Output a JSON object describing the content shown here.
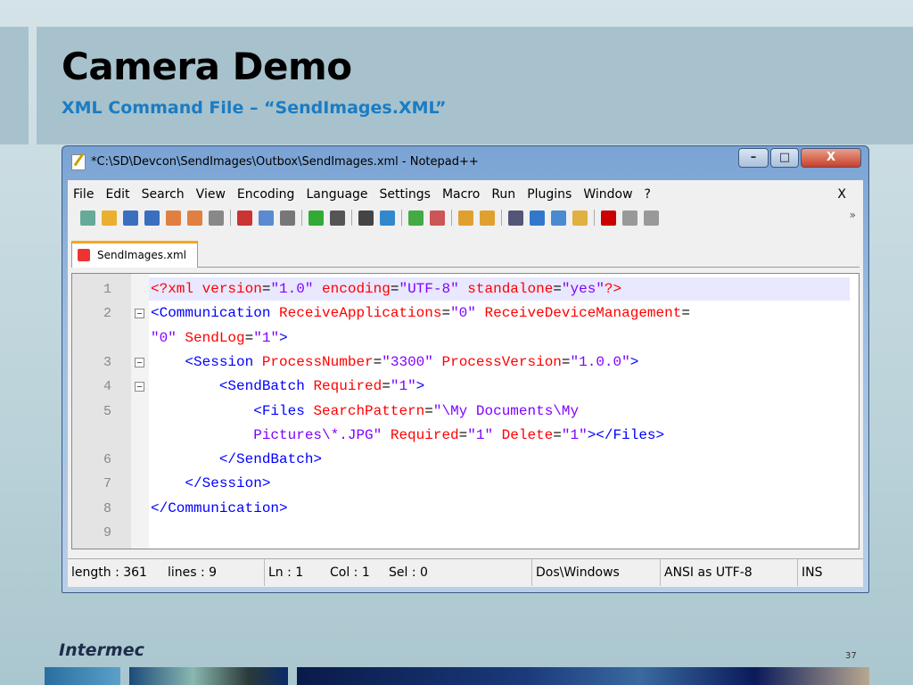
{
  "slide": {
    "title": "Camera Demo",
    "subtitle": "XML Command File – “SendImages.XML”",
    "page_number": "37",
    "logo": "Intermec"
  },
  "window": {
    "title": "*C:\\SD\\Devcon\\SendImages\\Outbox\\SendImages.xml - Notepad++",
    "minimize": "–",
    "maximize": "□",
    "close": "X"
  },
  "menu": [
    "File",
    "Edit",
    "Search",
    "View",
    "Encoding",
    "Language",
    "Settings",
    "Macro",
    "Run",
    "Plugins",
    "Window",
    "?"
  ],
  "menu_close": "X",
  "toolbar": {
    "icons": [
      "new-file",
      "open-file",
      "save",
      "save-all",
      "close",
      "close-all",
      "print",
      "|",
      "cut",
      "copy",
      "paste",
      "|",
      "undo",
      "redo",
      "|",
      "find",
      "replace",
      "|",
      "zoom-in",
      "zoom-out",
      "|",
      "sync-vertical",
      "sync-horizontal",
      "|",
      "word-wrap",
      "show-all-chars",
      "indent-guide",
      "user-lang",
      "|",
      "record-macro",
      "stop-macro",
      "play-macro"
    ],
    "overflow": "»"
  },
  "tab": {
    "label": "SendImages.xml"
  },
  "editor": {
    "lines": [
      {
        "n": "1",
        "tokens": [
          [
            "<?xml ",
            "attr"
          ],
          [
            "version",
            "attr"
          ],
          [
            "=",
            "pl"
          ],
          [
            "\"1.0\" ",
            "val"
          ],
          [
            "encoding",
            "attr"
          ],
          [
            "=",
            "pl"
          ],
          [
            "\"UTF-8\" ",
            "val"
          ],
          [
            "standalone",
            "attr"
          ],
          [
            "=",
            "pl"
          ],
          [
            "\"yes\"",
            "val"
          ],
          [
            "?>",
            "attr"
          ]
        ]
      },
      {
        "n": "2",
        "fold": true,
        "tokens": [
          [
            "<Communication ",
            "tag"
          ],
          [
            "ReceiveApplications",
            "attr"
          ],
          [
            "=",
            "pl"
          ],
          [
            "\"0\" ",
            "val"
          ],
          [
            "ReceiveDeviceManagement",
            "attr"
          ],
          [
            "=",
            "pl"
          ]
        ]
      },
      {
        "n": "",
        "tokens": [
          [
            "\"0\" ",
            "val"
          ],
          [
            "SendLog",
            "attr"
          ],
          [
            "=",
            "pl"
          ],
          [
            "\"1\"",
            "val"
          ],
          [
            ">",
            "tag"
          ]
        ]
      },
      {
        "n": "3",
        "fold": true,
        "tokens": [
          [
            "    <Session ",
            "tag"
          ],
          [
            "ProcessNumber",
            "attr"
          ],
          [
            "=",
            "pl"
          ],
          [
            "\"3300\" ",
            "val"
          ],
          [
            "ProcessVersion",
            "attr"
          ],
          [
            "=",
            "pl"
          ],
          [
            "\"1.0.0\"",
            "val"
          ],
          [
            ">",
            "tag"
          ]
        ]
      },
      {
        "n": "4",
        "fold": true,
        "tokens": [
          [
            "        <SendBatch ",
            "tag"
          ],
          [
            "Required",
            "attr"
          ],
          [
            "=",
            "pl"
          ],
          [
            "\"1\"",
            "val"
          ],
          [
            ">",
            "tag"
          ]
        ]
      },
      {
        "n": "5",
        "tokens": [
          [
            "            <Files ",
            "tag"
          ],
          [
            "SearchPattern",
            "attr"
          ],
          [
            "=",
            "pl"
          ],
          [
            "\"\\My Documents\\My",
            "val"
          ]
        ]
      },
      {
        "n": "",
        "tokens": [
          [
            "            Pictures\\*.JPG\" ",
            "val"
          ],
          [
            "Required",
            "attr"
          ],
          [
            "=",
            "pl"
          ],
          [
            "\"1\" ",
            "val"
          ],
          [
            "Delete",
            "attr"
          ],
          [
            "=",
            "pl"
          ],
          [
            "\"1\"",
            "val"
          ],
          [
            "></Files>",
            "tag"
          ]
        ]
      },
      {
        "n": "6",
        "tokens": [
          [
            "        </SendBatch>",
            "tag"
          ]
        ]
      },
      {
        "n": "7",
        "tokens": [
          [
            "    </Session>",
            "tag"
          ]
        ]
      },
      {
        "n": "8",
        "tokens": [
          [
            "</Communication>",
            "tag"
          ]
        ]
      },
      {
        "n": "9",
        "tokens": []
      }
    ]
  },
  "status": {
    "length": "length : 361",
    "lines": "lines : 9",
    "ln": "Ln : 1",
    "col": "Col : 1",
    "sel": "Sel : 0",
    "eol": "Dos\\Windows",
    "encoding": "ANSI as UTF-8",
    "mode": "INS"
  },
  "colors": {
    "tag": "#0000ff",
    "attribute": "#ff0000",
    "value": "#8000ff",
    "subtitle": "#1a7cc4"
  }
}
